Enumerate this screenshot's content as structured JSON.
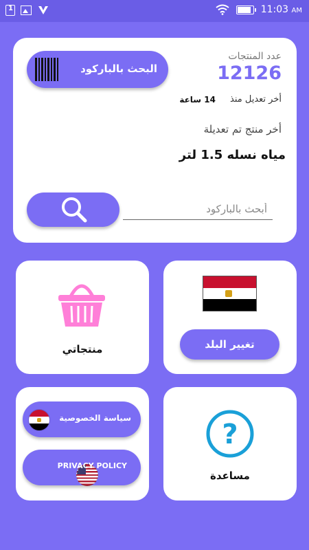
{
  "statusbar": {
    "time": "11:03",
    "ampm": "AM",
    "battery_level": 0.9
  },
  "header": {
    "barcode_button_label": "البحث بالباركود",
    "product_count_label": "عدد المنتجات",
    "product_count": "12126",
    "last_modified_label": "أخر تعديل منذ",
    "last_modified_value": "14 ساعة",
    "last_product_label": "أخر منتج تم تعديلة",
    "last_product_name": "مياه نسله 1.5 لتر",
    "search_placeholder": "أبحث بالباركود",
    "search_value": ""
  },
  "tiles": {
    "products_label": "منتجاتي",
    "change_country_label": "تغيير البلد",
    "privacy_ar_label": "سياسة الخصوصية",
    "privacy_en_label": "PRIVACY POLICY",
    "help_label": "مساعدة"
  },
  "colors": {
    "accent": "#7b6df4",
    "basket": "#ff7fd8",
    "help_icon": "#1aa0d8"
  }
}
